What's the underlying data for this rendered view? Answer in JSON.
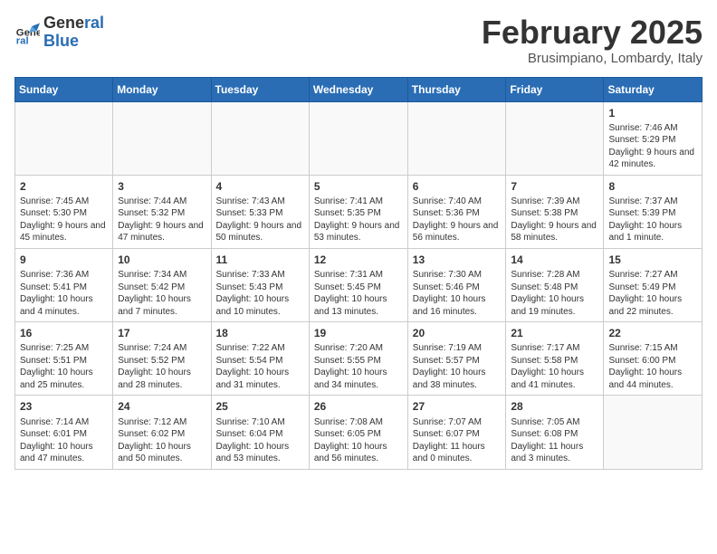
{
  "header": {
    "logo_line1": "General",
    "logo_line2": "Blue",
    "month": "February 2025",
    "location": "Brusimpiano, Lombardy, Italy"
  },
  "weekdays": [
    "Sunday",
    "Monday",
    "Tuesday",
    "Wednesday",
    "Thursday",
    "Friday",
    "Saturday"
  ],
  "weeks": [
    [
      {
        "day": "",
        "info": ""
      },
      {
        "day": "",
        "info": ""
      },
      {
        "day": "",
        "info": ""
      },
      {
        "day": "",
        "info": ""
      },
      {
        "day": "",
        "info": ""
      },
      {
        "day": "",
        "info": ""
      },
      {
        "day": "1",
        "info": "Sunrise: 7:46 AM\nSunset: 5:29 PM\nDaylight: 9 hours and 42 minutes."
      }
    ],
    [
      {
        "day": "2",
        "info": "Sunrise: 7:45 AM\nSunset: 5:30 PM\nDaylight: 9 hours and 45 minutes."
      },
      {
        "day": "3",
        "info": "Sunrise: 7:44 AM\nSunset: 5:32 PM\nDaylight: 9 hours and 47 minutes."
      },
      {
        "day": "4",
        "info": "Sunrise: 7:43 AM\nSunset: 5:33 PM\nDaylight: 9 hours and 50 minutes."
      },
      {
        "day": "5",
        "info": "Sunrise: 7:41 AM\nSunset: 5:35 PM\nDaylight: 9 hours and 53 minutes."
      },
      {
        "day": "6",
        "info": "Sunrise: 7:40 AM\nSunset: 5:36 PM\nDaylight: 9 hours and 56 minutes."
      },
      {
        "day": "7",
        "info": "Sunrise: 7:39 AM\nSunset: 5:38 PM\nDaylight: 9 hours and 58 minutes."
      },
      {
        "day": "8",
        "info": "Sunrise: 7:37 AM\nSunset: 5:39 PM\nDaylight: 10 hours and 1 minute."
      }
    ],
    [
      {
        "day": "9",
        "info": "Sunrise: 7:36 AM\nSunset: 5:41 PM\nDaylight: 10 hours and 4 minutes."
      },
      {
        "day": "10",
        "info": "Sunrise: 7:34 AM\nSunset: 5:42 PM\nDaylight: 10 hours and 7 minutes."
      },
      {
        "day": "11",
        "info": "Sunrise: 7:33 AM\nSunset: 5:43 PM\nDaylight: 10 hours and 10 minutes."
      },
      {
        "day": "12",
        "info": "Sunrise: 7:31 AM\nSunset: 5:45 PM\nDaylight: 10 hours and 13 minutes."
      },
      {
        "day": "13",
        "info": "Sunrise: 7:30 AM\nSunset: 5:46 PM\nDaylight: 10 hours and 16 minutes."
      },
      {
        "day": "14",
        "info": "Sunrise: 7:28 AM\nSunset: 5:48 PM\nDaylight: 10 hours and 19 minutes."
      },
      {
        "day": "15",
        "info": "Sunrise: 7:27 AM\nSunset: 5:49 PM\nDaylight: 10 hours and 22 minutes."
      }
    ],
    [
      {
        "day": "16",
        "info": "Sunrise: 7:25 AM\nSunset: 5:51 PM\nDaylight: 10 hours and 25 minutes."
      },
      {
        "day": "17",
        "info": "Sunrise: 7:24 AM\nSunset: 5:52 PM\nDaylight: 10 hours and 28 minutes."
      },
      {
        "day": "18",
        "info": "Sunrise: 7:22 AM\nSunset: 5:54 PM\nDaylight: 10 hours and 31 minutes."
      },
      {
        "day": "19",
        "info": "Sunrise: 7:20 AM\nSunset: 5:55 PM\nDaylight: 10 hours and 34 minutes."
      },
      {
        "day": "20",
        "info": "Sunrise: 7:19 AM\nSunset: 5:57 PM\nDaylight: 10 hours and 38 minutes."
      },
      {
        "day": "21",
        "info": "Sunrise: 7:17 AM\nSunset: 5:58 PM\nDaylight: 10 hours and 41 minutes."
      },
      {
        "day": "22",
        "info": "Sunrise: 7:15 AM\nSunset: 6:00 PM\nDaylight: 10 hours and 44 minutes."
      }
    ],
    [
      {
        "day": "23",
        "info": "Sunrise: 7:14 AM\nSunset: 6:01 PM\nDaylight: 10 hours and 47 minutes."
      },
      {
        "day": "24",
        "info": "Sunrise: 7:12 AM\nSunset: 6:02 PM\nDaylight: 10 hours and 50 minutes."
      },
      {
        "day": "25",
        "info": "Sunrise: 7:10 AM\nSunset: 6:04 PM\nDaylight: 10 hours and 53 minutes."
      },
      {
        "day": "26",
        "info": "Sunrise: 7:08 AM\nSunset: 6:05 PM\nDaylight: 10 hours and 56 minutes."
      },
      {
        "day": "27",
        "info": "Sunrise: 7:07 AM\nSunset: 6:07 PM\nDaylight: 11 hours and 0 minutes."
      },
      {
        "day": "28",
        "info": "Sunrise: 7:05 AM\nSunset: 6:08 PM\nDaylight: 11 hours and 3 minutes."
      },
      {
        "day": "",
        "info": ""
      }
    ]
  ]
}
